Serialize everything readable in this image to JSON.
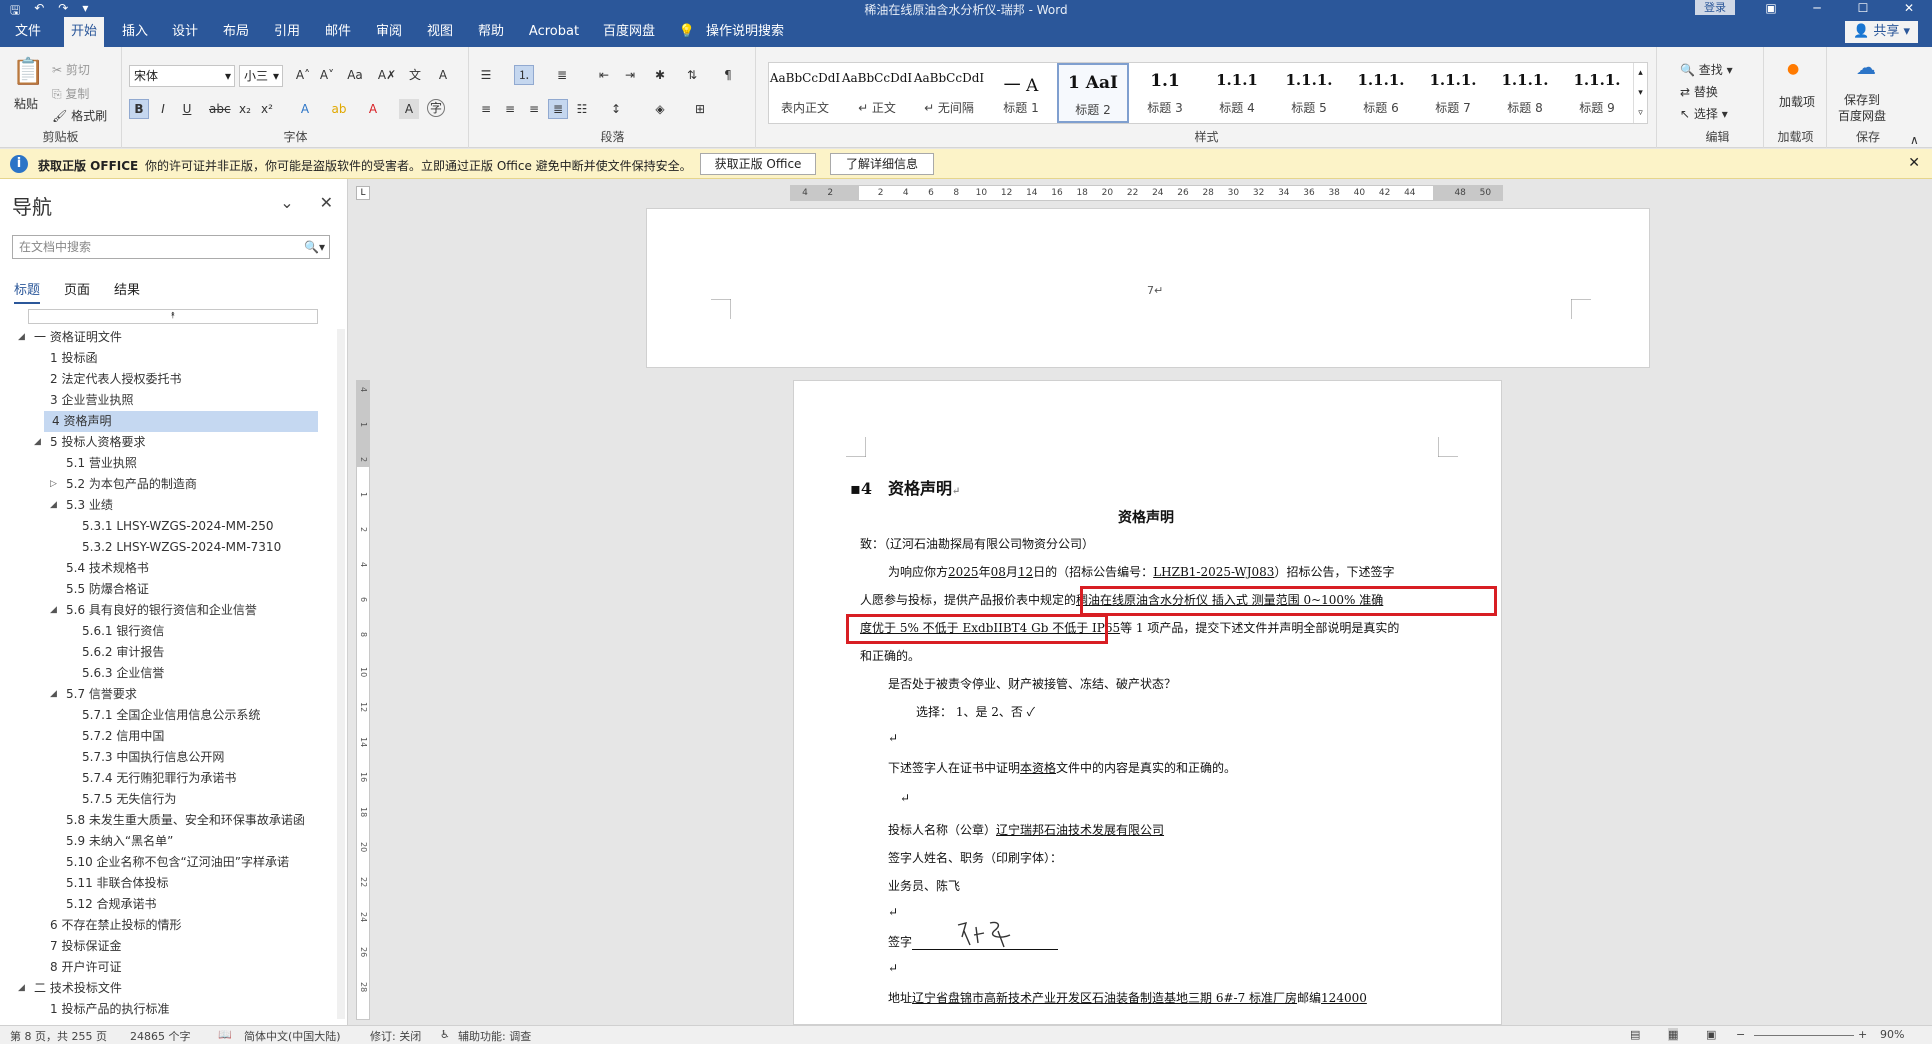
{
  "window": {
    "title": "稀油在线原油含水分析仪-瑞邦 - Word",
    "login": "登录",
    "share": "共享"
  },
  "tabs": [
    "文件",
    "开始",
    "插入",
    "设计",
    "布局",
    "引用",
    "邮件",
    "审阅",
    "视图",
    "帮助",
    "Acrobat",
    "百度网盘",
    "操作说明搜索"
  ],
  "ribbon": {
    "clipboard": {
      "label": "剪贴板",
      "paste": "粘贴",
      "cut": "剪切",
      "copy": "复制",
      "format_painter": "格式刷"
    },
    "font": {
      "label": "字体",
      "name": "宋体",
      "size": "小三"
    },
    "paragraph": {
      "label": "段落"
    },
    "styles": {
      "label": "样式",
      "items": [
        {
          "sample": "AaBbCcDdI",
          "name": "表内正文"
        },
        {
          "sample": "AaBbCcDdI",
          "name": "↵ 正文"
        },
        {
          "sample": "AaBbCcDdI",
          "name": "↵ 无间隔"
        },
        {
          "sample": "一 A",
          "name": "标题 1"
        },
        {
          "sample": "1 AaI",
          "name": "标题 2"
        },
        {
          "sample": "1.1",
          "name": "标题 3"
        },
        {
          "sample": "1.1.1",
          "name": "标题 4"
        },
        {
          "sample": "1.1.1.",
          "name": "标题 5"
        },
        {
          "sample": "1.1.1.",
          "name": "标题 6"
        },
        {
          "sample": "1.1.1.",
          "name": "标题 7"
        },
        {
          "sample": "1.1.1.",
          "name": "标题 8"
        },
        {
          "sample": "1.1.1.",
          "name": "标题 9"
        }
      ]
    },
    "editing": {
      "label": "编辑",
      "find": "查找",
      "replace": "替换",
      "select": "选择"
    },
    "addins": {
      "label": "加载项",
      "btn": "加载项"
    },
    "save": {
      "label": "保存",
      "btn1": "保存到",
      "btn2": "百度网盘"
    }
  },
  "warning": {
    "title": "获取正版 OFFICE",
    "message": "你的许可证并非正版，你可能是盗版软件的受害者。立即通过正版 Office 避免中断并使文件保持安全。",
    "btn_get": "获取正版 Office",
    "btn_more": "了解详细信息"
  },
  "nav": {
    "title": "导航",
    "search_placeholder": "在文档中搜索",
    "tabs": [
      "标题",
      "页面",
      "结果"
    ],
    "items": [
      {
        "level": 0,
        "arrow": "◢",
        "text": "一 资格证明文件"
      },
      {
        "level": 1,
        "text": "1 投标函"
      },
      {
        "level": 1,
        "text": "2 法定代表人授权委托书"
      },
      {
        "level": 1,
        "text": "3 企业营业执照"
      },
      {
        "level": 1,
        "text": "4 资格声明",
        "selected": true
      },
      {
        "level": 1,
        "arrow": "◢",
        "text": "5 投标人资格要求"
      },
      {
        "level": 2,
        "text": "5.1 营业执照"
      },
      {
        "level": 2,
        "arrow": "▷",
        "text": "5.2 为本包产品的制造商"
      },
      {
        "level": 2,
        "arrow": "◢",
        "text": "5.3 业绩"
      },
      {
        "level": 3,
        "text": "5.3.1 LHSY-WZGS-2024-MM-250"
      },
      {
        "level": 3,
        "text": "5.3.2 LHSY-WZGS-2024-MM-7310"
      },
      {
        "level": 2,
        "text": "5.4 技术规格书"
      },
      {
        "level": 2,
        "text": "5.5 防爆合格证"
      },
      {
        "level": 2,
        "arrow": "◢",
        "text": "5.6 具有良好的银行资信和企业信誉"
      },
      {
        "level": 3,
        "text": "5.6.1 银行资信"
      },
      {
        "level": 3,
        "text": "5.6.2 审计报告"
      },
      {
        "level": 3,
        "text": "5.6.3 企业信誉"
      },
      {
        "level": 2,
        "arrow": "◢",
        "text": "5.7 信誉要求"
      },
      {
        "level": 3,
        "text": "5.7.1 全国企业信用信息公示系统"
      },
      {
        "level": 3,
        "text": "5.7.2 信用中国"
      },
      {
        "level": 3,
        "text": "5.7.3 中国执行信息公开网"
      },
      {
        "level": 3,
        "text": "5.7.4 无行贿犯罪行为承诺书"
      },
      {
        "level": 3,
        "text": "5.7.5 无失信行为"
      },
      {
        "level": 2,
        "text": "5.8 未发生重大质量、安全和环保事故承诺函"
      },
      {
        "level": 2,
        "text": "5.9 未纳入“黑名单”"
      },
      {
        "level": 2,
        "text": "5.10 企业名称不包含“辽河油田”字样承诺"
      },
      {
        "level": 2,
        "text": "5.11 非联合体投标"
      },
      {
        "level": 2,
        "text": "5.12 合规承诺书"
      },
      {
        "level": 1,
        "text": "6 不存在禁止投标的情形"
      },
      {
        "level": 1,
        "text": "7 投标保证金"
      },
      {
        "level": 1,
        "text": "8 开户许可证"
      },
      {
        "level": 0,
        "arrow": "◢",
        "text": "二 技术投标文件"
      },
      {
        "level": 1,
        "text": "1 投标产品的执行标准"
      }
    ]
  },
  "hruler_ticks": [
    "4",
    "2",
    "",
    "2",
    "4",
    "6",
    "8",
    "10",
    "12",
    "14",
    "16",
    "18",
    "20",
    "22",
    "24",
    "26",
    "28",
    "30",
    "32",
    "34",
    "36",
    "38",
    "40",
    "42",
    "44",
    "",
    "48",
    "50"
  ],
  "vruler_ticks": [
    "4",
    "1",
    "2",
    "1",
    "2",
    "4",
    "6",
    "8",
    "10",
    "12",
    "14",
    "16",
    "18",
    "20",
    "22",
    "24",
    "26",
    "28"
  ],
  "page1": {
    "number": "7↵"
  },
  "doc": {
    "heading": "4　资格声明",
    "title": "资格声明",
    "to": "致：（辽河石油勘探局有限公司物资分公司）",
    "p1_a": "为响应你方",
    "p1_year": "2025",
    "p1_b": "年",
    "p1_month": "08",
    "p1_c": "月",
    "p1_day": "12",
    "p1_d": "日的（招标公告编号：",
    "p1_code": "LHZB1-2025-WJ083",
    "p1_e": "）招标公告，下述签字",
    "p2_a": "人愿参与投标，提供产品报价表中规定的",
    "p2_product": "稠油在线原油含水分析仪  插入式  测量范围 0~100%  准确",
    "p3_product": "度优于 5%  不低于 ExdbIIBT4 Gb  不低于 IP65",
    "p3_rest": "等 1 项产品，提交下述文件并声明全部说明是真实的",
    "p4": "和正确的。",
    "q1": "是否处于被责令停业、财产被接管、冻结、破产状态？",
    "q1_choice": "选择：  1、是               2、否 ✓",
    "decl_a": "下述签字人在证书中证明",
    "decl_b": "本资格",
    "decl_c": "文件中的内容是真实的和正确的。",
    "bidder_label": "投标人名称（公章）",
    "bidder_name": "辽宁瑞邦石油技术发展有限公司",
    "signer_label": "签字人姓名、职务（印刷字体）：",
    "signer": "业务员、陈飞",
    "sign_label": "签字",
    "signature": "陈飞",
    "addr_label": "地址",
    "address": "辽宁省盘锦市高新技术产业开发区石油装备制造基地三期 6#-7 标准厂房",
    "zip_label": "邮编",
    "zip": "124000"
  },
  "status": {
    "page": "第 8 页，共 255 页",
    "words": "24865 个字",
    "lang": "简体中文(中国大陆)",
    "track": "修订: 关闭",
    "access": "辅助功能: 调查",
    "zoom": "90%"
  },
  "colors": {
    "accent": "#2b579a",
    "highlight_box": "#d81e23"
  }
}
